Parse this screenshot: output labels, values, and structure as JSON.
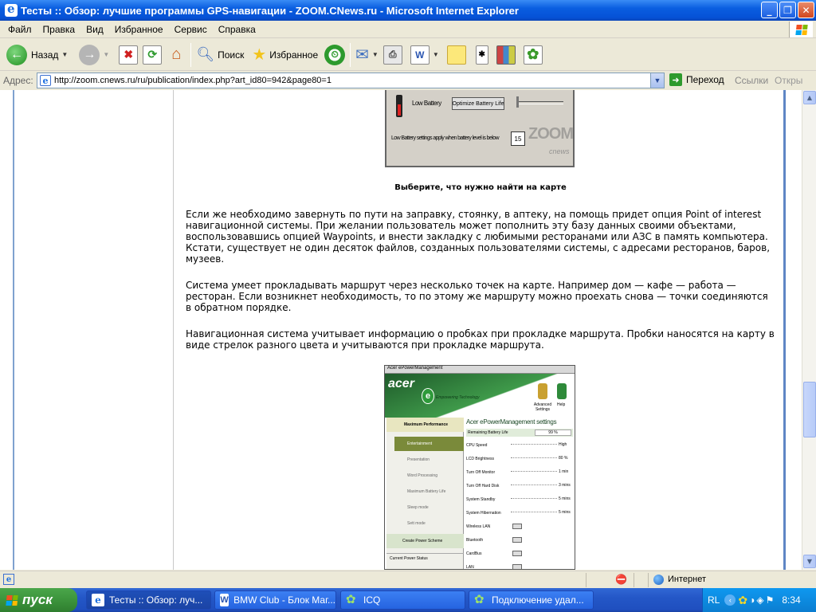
{
  "window": {
    "title": "Тесты :: Обзор: лучшие программы GPS-навигации - ZOOM.CNews.ru - Microsoft Internet Explorer"
  },
  "menu": [
    "Файл",
    "Правка",
    "Вид",
    "Избранное",
    "Сервис",
    "Справка"
  ],
  "toolbar": {
    "back_label": "Назад",
    "search_label": "Поиск",
    "favorites_label": "Избранное"
  },
  "address": {
    "label": "Адрес:",
    "url": "http://zoom.cnews.ru/ru/publication/index.php?art_id80=942&page80=1",
    "go_label": "Переход",
    "links_label": "Ссылки",
    "links2_label": "Откры"
  },
  "page": {
    "screenshot1": {
      "low_battery": "Low Battery",
      "button": "Optimize Battery Life",
      "threshold": "Low Battery settings apply when battery level is below",
      "value": "15",
      "watermark": "ZOOM",
      "watermark_sub": "cnews"
    },
    "caption": "Выберите, что нужно найти на карте",
    "paragraphs": [
      "Если же необходимо завернуть по пути на заправку, стоянку, в аптеку, на помощь придет опция Point of interest навигационной системы. При желании пользователь может пополнить эту базу данных своими объектами, воспользовавшись опцией Waypoints, и внести закладку с любимыми ресторанами или АЗС в память компьютера. Кстати, существует не один десяток файлов, созданных пользователями системы, с адресами ресторанов, баров, музеев.",
      "Система умеет прокладывать маршрут через несколько точек на карте. Например дом — кафе — работа — ресторан. Если возникнет необходимость, то по этому же маршруту можно проехать снова — точки соединяются в обратном порядке.",
      "Навигационная система учитывает информацию о пробках при прокладке маршрута. Пробки наносятся на карту в виде стрелок разного цвета и учитываются при прокладке маршрута."
    ],
    "screenshot2": {
      "window_title": "Acer ePowerManagement",
      "brand": "acer",
      "tagline": "Empowering Technology",
      "advanced": "Advanced Settings",
      "help": "Help",
      "settings_title": "Acer ePowerManagement settings",
      "remaining": "Remaining Battery Life",
      "remaining_value": "99 %",
      "profiles": [
        "Maximum Performance",
        "Entertainment",
        "Presentation",
        "Word Processing",
        "Maximum Battery Life",
        "Sleep mode",
        "Sett mode"
      ],
      "create_scheme": "Create Power Scheme",
      "current_status": "Current Power Status",
      "settings": [
        {
          "name": "CPU Speed",
          "value": "High"
        },
        {
          "name": "LCD Brightness",
          "value": "80 %"
        },
        {
          "name": "Turn Off Monitor",
          "value": "1 min"
        },
        {
          "name": "Turn Off Hard Disk",
          "value": "3 mins"
        },
        {
          "name": "System Standby",
          "value": "5 mins"
        },
        {
          "name": "System Hibernation",
          "value": "5 mins"
        },
        {
          "name": "Wireless LAN",
          "value": ""
        },
        {
          "name": "Bluetooth",
          "value": ""
        },
        {
          "name": "CardBus",
          "value": ""
        },
        {
          "name": "LAN",
          "value": ""
        }
      ]
    }
  },
  "status": {
    "zone": "Интернет"
  },
  "taskbar": {
    "start_label": "пуск",
    "tasks": [
      "Тесты :: Обзор: луч...",
      "BMW Club - Блок Маг...",
      "ICQ",
      "Подключение удал..."
    ],
    "lang": "RL",
    "clock": "8:34"
  },
  "colors": {
    "title_bar": "#0a5ee0",
    "taskbar": "#2457c7",
    "start_button": "#3c943c",
    "acer_green": "#2e7d3b"
  }
}
